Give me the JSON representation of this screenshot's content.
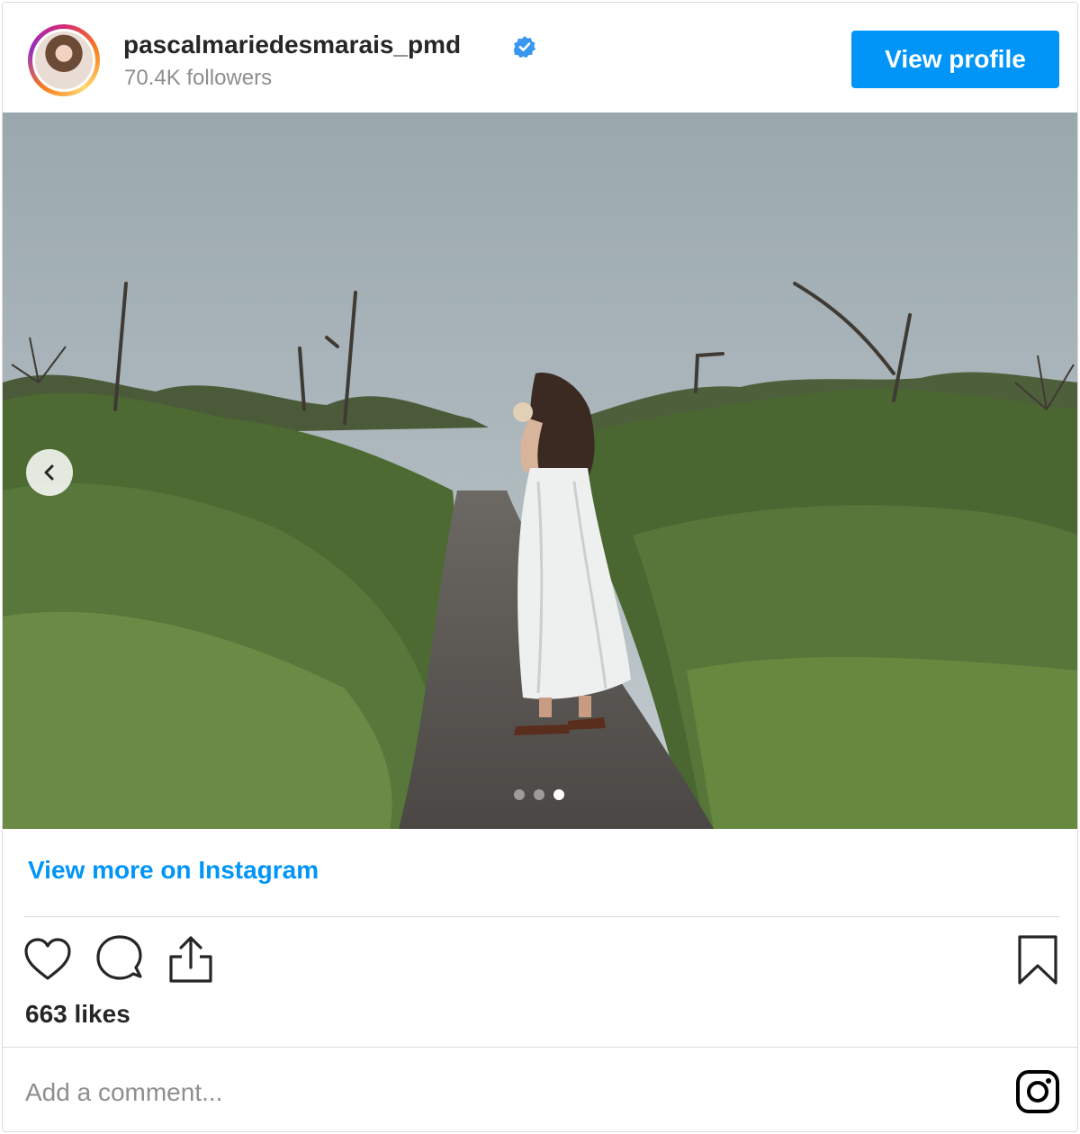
{
  "header": {
    "username": "pascalmariedesmarais_pmd",
    "followers": "70.4K followers",
    "verified": true,
    "view_profile_label": "View profile"
  },
  "post": {
    "carousel": {
      "total_slides": 3,
      "active_slide": 3
    }
  },
  "footer": {
    "view_more_label": "View more on Instagram",
    "likes": "663 likes",
    "comment_placeholder": "Add a comment..."
  },
  "icons": {
    "verified": "verified-badge-icon",
    "prev": "chevron-left-icon",
    "like": "heart-icon",
    "comment": "comment-bubble-icon",
    "share": "share-icon",
    "save": "bookmark-icon",
    "brand": "instagram-logo-icon"
  },
  "colors": {
    "accent": "#0095f6",
    "text": "#262626",
    "muted": "#8e8e8e",
    "border": "#dbdbdb"
  }
}
